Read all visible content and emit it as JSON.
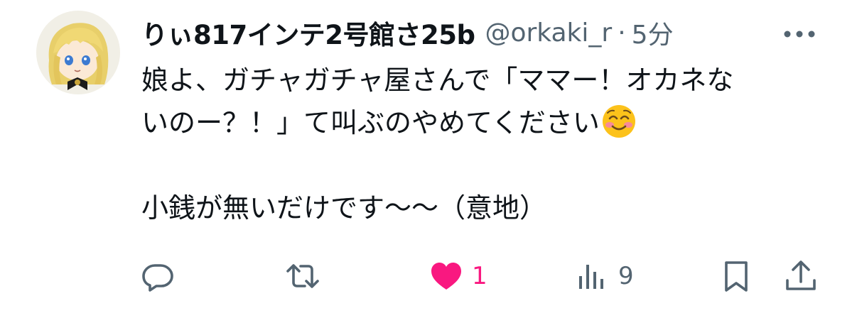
{
  "tweet": {
    "display_name": "りぃ817インテ2号館さ25b",
    "handle": "@orkaki_r",
    "separator": "·",
    "time": "5分",
    "body_lines": [
      "娘よ、ガチャガチャ屋さんで「ママー！オカネな",
      "いのー？！」て叫ぶのやめてください",
      "",
      "小銭が無いだけです〜〜（意地）"
    ],
    "emoji": "smiling-face-with-smiling-eyes"
  },
  "actions": {
    "reply": {
      "icon": "reply-icon",
      "count": ""
    },
    "retweet": {
      "icon": "retweet-icon",
      "count": ""
    },
    "like": {
      "icon": "heart-icon",
      "count": "1",
      "active": true,
      "color": "#f91880"
    },
    "views": {
      "icon": "analytics-icon",
      "count": "9"
    },
    "bookmark": {
      "icon": "bookmark-icon"
    },
    "share": {
      "icon": "share-icon"
    }
  },
  "colors": {
    "text_primary": "#0f1419",
    "text_secondary": "#536471",
    "like_active": "#f91880"
  }
}
